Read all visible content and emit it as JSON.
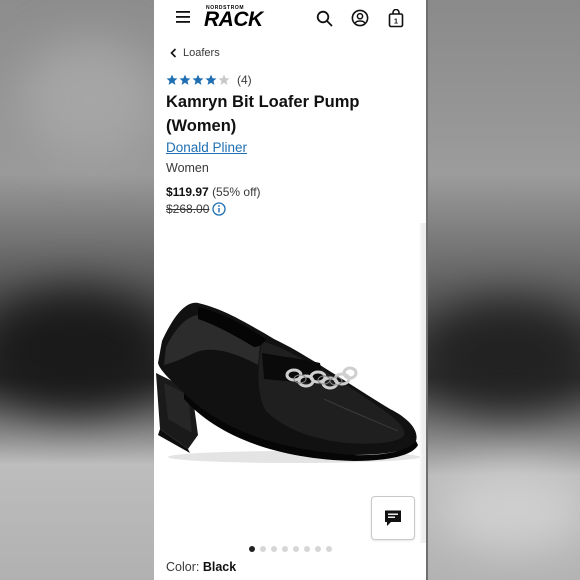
{
  "header": {
    "logo_small": "NORDSTROM",
    "logo_big": "RACK"
  },
  "breadcrumb": {
    "label": "Loafers"
  },
  "product": {
    "rating": 4,
    "rating_max": 5,
    "review_count": "(4)",
    "title": "Kamryn Bit Loafer Pump (Women)",
    "brand": "Donald Pliner",
    "department": "Women",
    "sale_price": "$119.97",
    "discount": "(55% off)",
    "original_price": "$268.00"
  },
  "gallery": {
    "image_count": 8,
    "active_index": 0
  },
  "selection": {
    "color_label": "Color:",
    "color_value": "Black"
  },
  "colors": {
    "link": "#1f6fb2",
    "star": "#1f6fb2",
    "star_empty": "#c9c9c9"
  }
}
